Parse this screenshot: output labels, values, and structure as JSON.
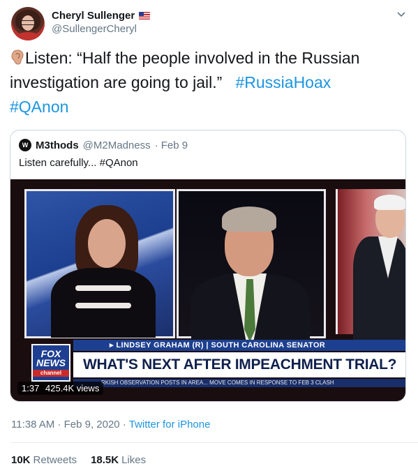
{
  "author": {
    "display_name": "Cheryl Sullenger",
    "handle": "@SullengerCheryl",
    "flag_icon": "us-flag-icon"
  },
  "tweet": {
    "text": "Listen: “Half the people involved in the Russian investigation are going to jail.”",
    "hashtags": [
      "#RussiaHoax",
      "#QAnon"
    ],
    "emoji_icon": "ear-icon"
  },
  "quoted_tweet": {
    "avatar_text": "W",
    "display_name": "M3thods",
    "handle": "@M2Madness",
    "date": "· Feb 9",
    "text": "Listen carefully... #QAnon",
    "video": {
      "duration": "1:37",
      "views": "425.4K views",
      "network_logo": [
        "FOX",
        "NEWS"
      ],
      "network_sub": "channel",
      "chyron_name": "▸ LINDSEY GRAHAM (R) | SOUTH CAROLINA SENATOR",
      "chyron_headline": "WHAT'S NEXT AFTER IMPEACHMENT TRIAL?",
      "ticker": "RKISH OBSERVATION POSTS IN AREA...   MOVE COMES IN RESPONSE TO FEB 3 CLASH"
    }
  },
  "meta": {
    "time_date": "11:38 AM · Feb 9, 2020 · ",
    "source": "Twitter for iPhone"
  },
  "stats": {
    "retweets_count": "10K",
    "retweets_label": "Retweets",
    "likes_count": "18.5K",
    "likes_label": "Likes"
  },
  "colors": {
    "link": "#1b95e0",
    "secondary_text": "#657786",
    "border": "#ccd6dd"
  }
}
